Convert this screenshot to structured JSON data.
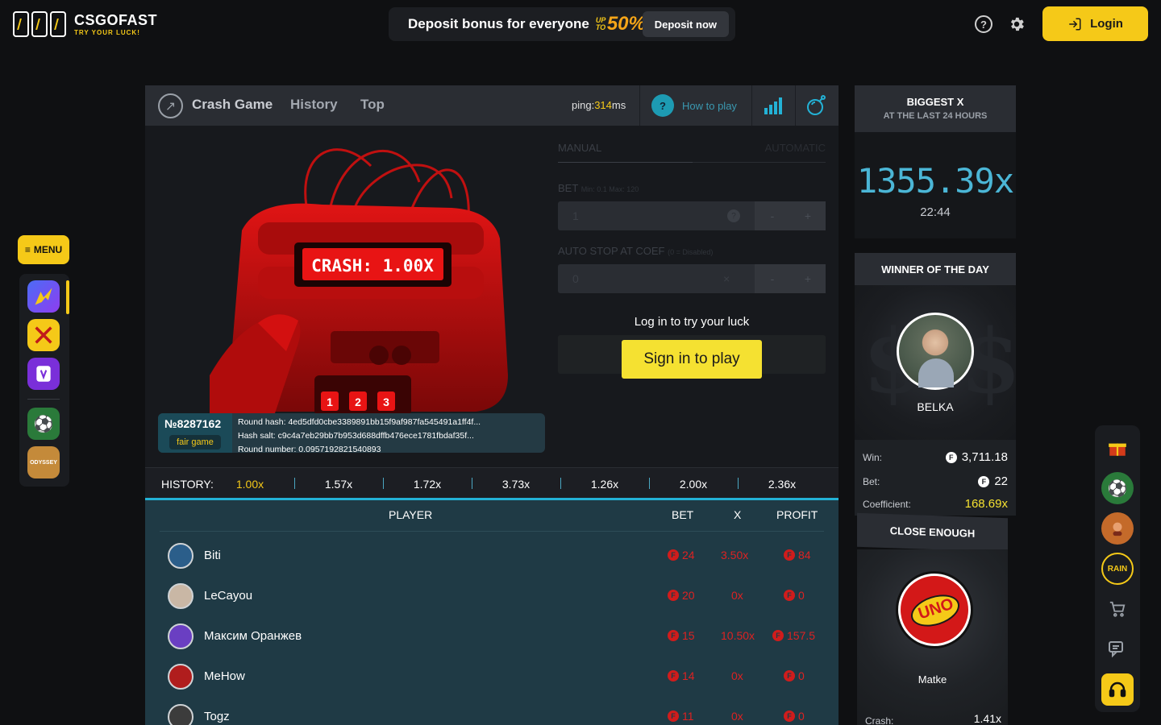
{
  "header": {
    "logo_title": "CSGOFAST",
    "logo_tagline": "TRY YOUR LUCK!",
    "promo_text": "Deposit bonus for everyone",
    "promo_upto": "UP TO",
    "promo_percent": "50%",
    "promo_button": "Deposit now",
    "login_label": "Login"
  },
  "left_menu": {
    "menu_label": "MENU",
    "items": [
      {
        "icon": "crash-game-icon"
      },
      {
        "icon": "swords-game-icon"
      },
      {
        "icon": "slot-game-icon"
      },
      {
        "icon": "football-icon"
      },
      {
        "icon": "odyssey-icon"
      }
    ]
  },
  "game": {
    "tabs": [
      "Crash Game",
      "History",
      "Top"
    ],
    "ping_label": "ping:",
    "ping_value": "314",
    "ping_unit": "ms",
    "how_to_play": "How to play",
    "crash_display": "CRASH: 1.00X",
    "bomb_keys": [
      "1",
      "2",
      "3"
    ],
    "round": {
      "number": "№8287162",
      "fair_label": "fair game",
      "hash": "Round hash: 4ed5dfd0cbe3389891bb15f9af987fa545491a1ff4f...",
      "salt": "Hash salt: c9c4a7eb29bb7b953d688dffb476ece1781fbdaf35f...",
      "round_number": "Round number: 0.09571928215408​93"
    },
    "controls": {
      "mode_manual": "MANUAL",
      "mode_auto": "AUTOMATIC",
      "bet_label": "BET",
      "bet_hint": "Min: 0.1 Max: 120",
      "bet_value": "1",
      "autostop_label": "AUTO STOP AT COEF",
      "autostop_hint": "(0 = Disabled)",
      "autostop_value": "0",
      "minus": "-",
      "plus": "+",
      "clear": "×",
      "help": "?",
      "login_hint": "Log in to try your luck",
      "signin_button": "Sign in to play"
    },
    "history_label": "HISTORY:",
    "history": [
      "1.00x",
      "1.57x",
      "1.72x",
      "3.73x",
      "1.26x",
      "2.00x",
      "2.36x"
    ],
    "players_columns": {
      "player": "PLAYER",
      "bet": "BET",
      "x": "X",
      "profit": "PROFIT"
    },
    "players": [
      {
        "name": "Biti",
        "bet": "24",
        "x": "3.50x",
        "profit": "84",
        "avatar_color": "#2b5e8a"
      },
      {
        "name": "LeCayou",
        "bet": "20",
        "x": "0x",
        "profit": "0",
        "avatar_color": "#c9b7a5"
      },
      {
        "name": "Максим Оранжев",
        "bet": "15",
        "x": "10.50x",
        "profit": "157.5",
        "avatar_color": "#6a3fc2"
      },
      {
        "name": "MeHow",
        "bet": "14",
        "x": "0x",
        "profit": "0",
        "avatar_color": "#b01d1d"
      },
      {
        "name": "Togz",
        "bet": "11",
        "x": "0x",
        "profit": "0",
        "avatar_color": "#3c3c3c"
      }
    ]
  },
  "biggest": {
    "title": "BIGGEST X",
    "subtitle": "AT THE LAST 24 HOURS",
    "value": "1355.39x",
    "time": "22:44"
  },
  "winner_of_day": {
    "title": "WINNER OF THE DAY",
    "name": "BELKA",
    "win_label": "Win:",
    "win_value": "3,711.18",
    "bet_label": "Bet:",
    "bet_value": "22",
    "coef_label": "Coefficient:",
    "coef_value": "168.69x"
  },
  "close_enough": {
    "title": "CLOSE ENOUGH",
    "logo_text": "UNO",
    "name": "Matke",
    "crash_label": "Crash:",
    "crash_value": "1.41x"
  },
  "right_rail": {
    "rain_label": "RAIN"
  }
}
